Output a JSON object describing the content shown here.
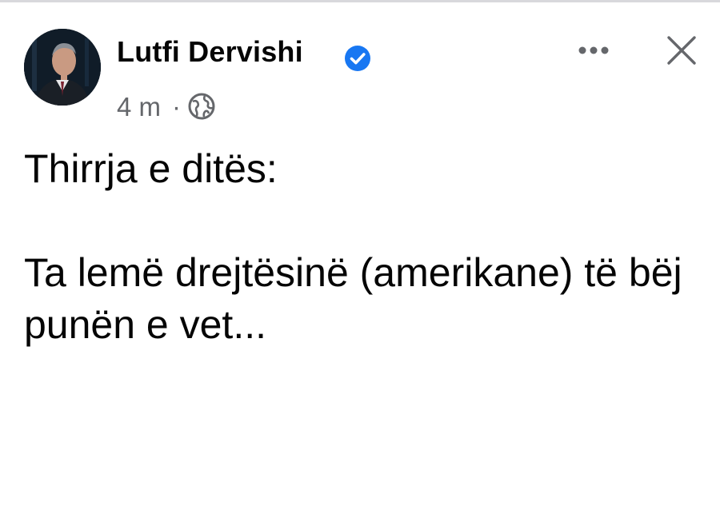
{
  "post": {
    "author": {
      "name": "Lutfi Dervishi",
      "verified": true,
      "avatar_icon": "profile-photo"
    },
    "meta": {
      "time": "4 m",
      "separator": "·",
      "audience_icon": "globe-icon"
    },
    "actions": {
      "more_icon": "more-horizontal-icon",
      "close_icon": "close-icon"
    },
    "body": {
      "line_1": "Thirrja e ditës:",
      "paragraph_2": "Ta lemë drejtësinë (amerikane) të bëj punën e vet..."
    }
  },
  "colors": {
    "text_primary": "#050505",
    "text_secondary": "#65676b",
    "verified_blue": "#1877f2",
    "background": "#ffffff"
  }
}
